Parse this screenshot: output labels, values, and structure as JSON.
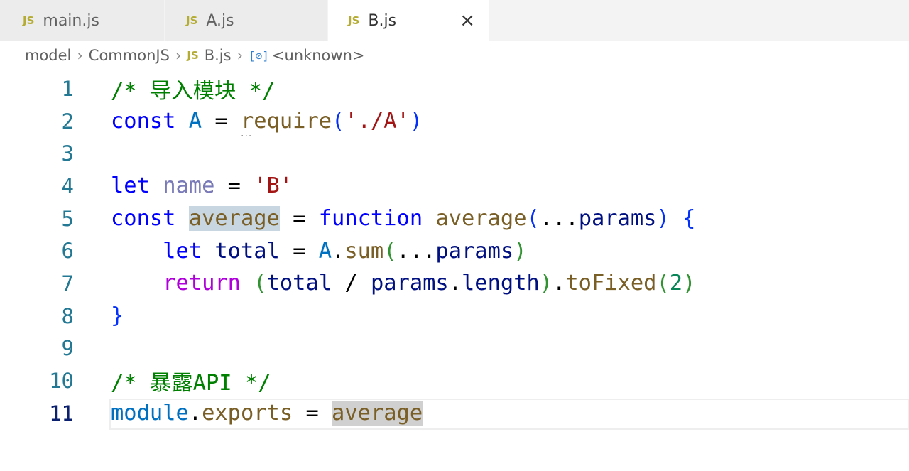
{
  "tabs": [
    {
      "label": "main.js",
      "icon": "JS"
    },
    {
      "label": "A.js",
      "icon": "JS"
    },
    {
      "label": "B.js",
      "icon": "JS",
      "active": true
    }
  ],
  "close_icon": "×",
  "breadcrumb": {
    "items": [
      "model",
      "CommonJS",
      "B.js",
      "<unknown>"
    ],
    "sep": "›",
    "js_icon": "JS",
    "symbol_icon": "[⊘]"
  },
  "lines": [
    {
      "n": "1",
      "tokens": [
        [
          "/* 导入模块 */",
          "cm"
        ]
      ]
    },
    {
      "n": "2",
      "tokens": [
        [
          "const ",
          "kw"
        ],
        [
          "A",
          "var"
        ],
        [
          " = ",
          ""
        ],
        [
          "require",
          "fn"
        ],
        [
          "(",
          "brk"
        ],
        [
          "'./A'",
          "str"
        ],
        [
          ")",
          "brk"
        ]
      ]
    },
    {
      "n": "3",
      "tokens": []
    },
    {
      "n": "4",
      "tokens": [
        [
          "let ",
          "kw"
        ],
        [
          "name",
          "unused"
        ],
        [
          " = ",
          ""
        ],
        [
          "'B'",
          "str"
        ]
      ]
    },
    {
      "n": "5",
      "tokens": [
        [
          "const ",
          "kw"
        ],
        [
          "average",
          "fn hl"
        ],
        [
          " = ",
          ""
        ],
        [
          "function ",
          "kw"
        ],
        [
          "average",
          "fn"
        ],
        [
          "(",
          "brk"
        ],
        [
          "...",
          ""
        ],
        [
          "params",
          "param"
        ],
        [
          ")",
          "brk"
        ],
        [
          " ",
          ""
        ],
        [
          "{",
          "brk"
        ]
      ]
    },
    {
      "n": "6",
      "tokens": [
        [
          "    let ",
          "kw"
        ],
        [
          "total",
          "param"
        ],
        [
          " = ",
          ""
        ],
        [
          "A",
          "var"
        ],
        [
          ".",
          ""
        ],
        [
          "sum",
          "fn"
        ],
        [
          "(",
          "brk2"
        ],
        [
          "...",
          ""
        ],
        [
          "params",
          "param"
        ],
        [
          ")",
          "brk2"
        ]
      ]
    },
    {
      "n": "7",
      "tokens": [
        [
          "    return ",
          "ctl"
        ],
        [
          "(",
          "brk2"
        ],
        [
          "total",
          "param"
        ],
        [
          " / ",
          ""
        ],
        [
          "params",
          "param"
        ],
        [
          ".",
          ""
        ],
        [
          "length",
          "param"
        ],
        [
          ")",
          "brk2"
        ],
        [
          ".",
          ""
        ],
        [
          "toFixed",
          "fn"
        ],
        [
          "(",
          "brk2"
        ],
        [
          "2",
          "num"
        ],
        [
          ")",
          "brk2"
        ]
      ]
    },
    {
      "n": "8",
      "tokens": [
        [
          "}",
          "brk"
        ]
      ]
    },
    {
      "n": "9",
      "tokens": []
    },
    {
      "n": "10",
      "tokens": [
        [
          "/* 暴露API */",
          "cm"
        ]
      ]
    },
    {
      "n": "11",
      "tokens": [
        [
          "module",
          "var"
        ],
        [
          ".",
          ""
        ],
        [
          "exports",
          "fn"
        ],
        [
          " = ",
          ""
        ],
        [
          "average",
          "fn hl2"
        ]
      ]
    }
  ],
  "current_line": "11"
}
